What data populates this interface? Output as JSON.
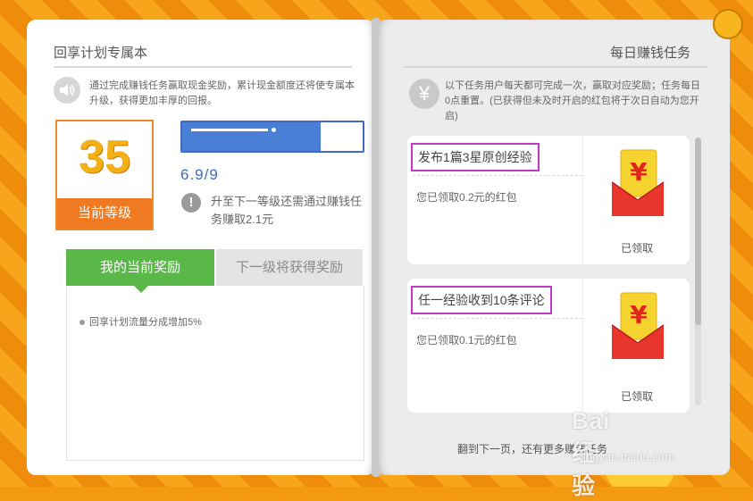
{
  "left": {
    "title": "回享计划专属本",
    "intro": "通过完成赚钱任务赢取现金奖励，累计现金额度还将使专属本升级，获得更加丰厚的回报。",
    "level": {
      "number": "35",
      "label": "当前等级"
    },
    "progress": {
      "text": "6.9/9",
      "fraction": 0.767
    },
    "upgrade_note": "升至下一等级还需通过赚钱任务赚取2.1元",
    "tabs": {
      "current": "我的当前奖励",
      "next": "下一级将获得奖励"
    },
    "rewards": [
      "回享计划流量分成增加5%"
    ]
  },
  "right": {
    "title": "每日赚钱任务",
    "intro": "以下任务用户每天都可完成一次，赢取对应奖励；任务每日0点重置。(已获得但未及时开启的红包将于次日自动为您开启)",
    "tasks": [
      {
        "name": "发布1篇3星原创经验",
        "desc": "您已领取0.2元的红包",
        "status": "已领取"
      },
      {
        "name": "任一经验收到10条评论",
        "desc": "您已领取0.1元的红包",
        "status": "已领取"
      }
    ],
    "footer": "翻到下一页，还有更多赚钱任务"
  },
  "watermark": {
    "logo": "Bai 经验",
    "url": "jingyan.baidu.com"
  },
  "colors": {
    "accent_orange": "#f07a22",
    "progress_blue": "#4a7fd6",
    "tab_green": "#5ab848",
    "highlight": "#c338c9"
  }
}
